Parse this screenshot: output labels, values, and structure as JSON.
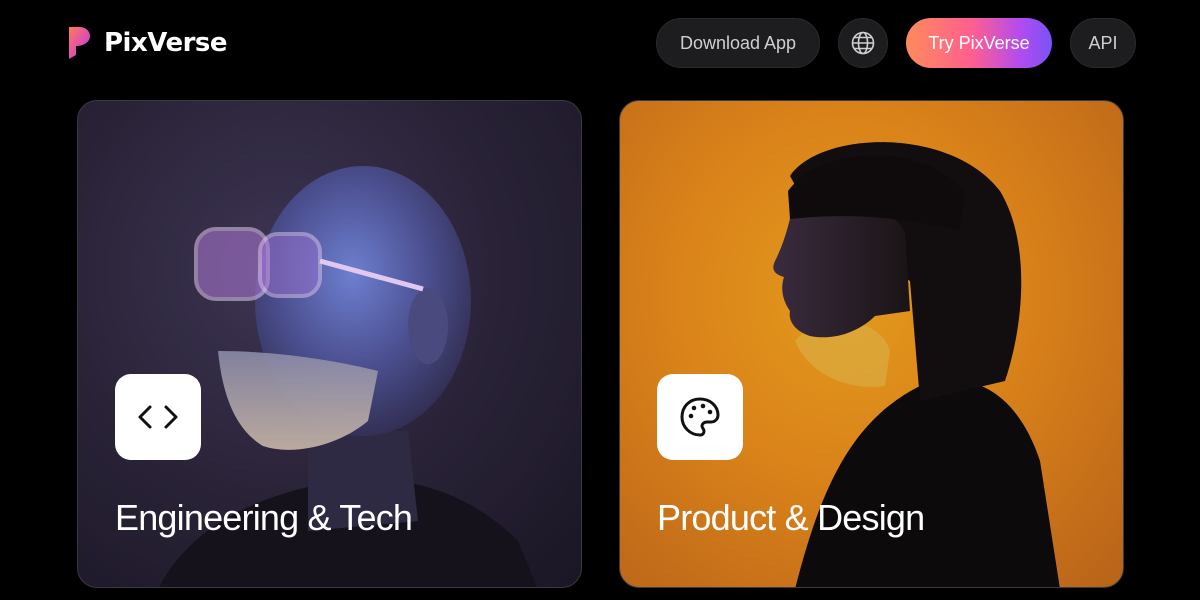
{
  "brand": {
    "name": "PixVerse"
  },
  "nav": {
    "download_label": "Download App",
    "try_label": "Try PixVerse",
    "api_label": "API",
    "globe_icon": "globe-icon"
  },
  "cards": [
    {
      "title": "Engineering & Tech",
      "icon": "code-brackets-icon",
      "image": "portrait of bearded bald man with clear glasses in blue-purple light"
    },
    {
      "title": "Product & Design",
      "icon": "palette-icon",
      "image": "profile of woman with bob haircut against orange backdrop"
    }
  ],
  "colors": {
    "background": "#000000",
    "pill_bg": "#1d1d1f",
    "cta_gradient": [
      "#ff8a5b",
      "#ff5f8f",
      "#b24cf0",
      "#7a52f5"
    ],
    "card_eng_bg": "#2a2338",
    "card_prod_bg": "#d9821a"
  }
}
